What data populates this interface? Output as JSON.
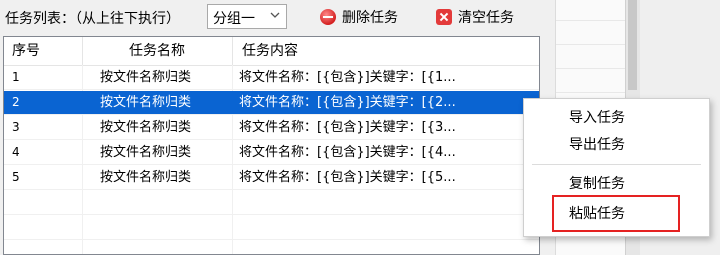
{
  "toolbar": {
    "list_label": "任务列表：（从上往下执行）",
    "group_select": {
      "value": "分组一"
    },
    "delete_label": "删除任务",
    "clear_label": "清空任务"
  },
  "table": {
    "columns": [
      "序号",
      "任务名称",
      "任务内容"
    ],
    "rows": [
      {
        "index": "1",
        "name": "按文件名称归类",
        "content": "将文件名称：[{包含}]关键字：[{1..."
      },
      {
        "index": "2",
        "name": "按文件名称归类",
        "content": "将文件名称：[{包含}]关键字：[{2..."
      },
      {
        "index": "3",
        "name": "按文件名称归类",
        "content": "将文件名称：[{包含}]关键字：[{3..."
      },
      {
        "index": "4",
        "name": "按文件名称归类",
        "content": "将文件名称：[{包含}]关键字：[{4..."
      },
      {
        "index": "5",
        "name": "按文件名称归类",
        "content": "将文件名称：[{包含}]关键字：[{5..."
      }
    ],
    "selected_index": "2"
  },
  "context_menu": {
    "items": [
      "导入任务",
      "导出任务",
      "复制任务",
      "粘贴任务"
    ],
    "highlighted": "粘贴任务"
  },
  "colors": {
    "selection": "#0a64d2",
    "highlight_border": "#e52222",
    "delete_icon": "#d42020",
    "clear_icon": "#e33a3a"
  }
}
